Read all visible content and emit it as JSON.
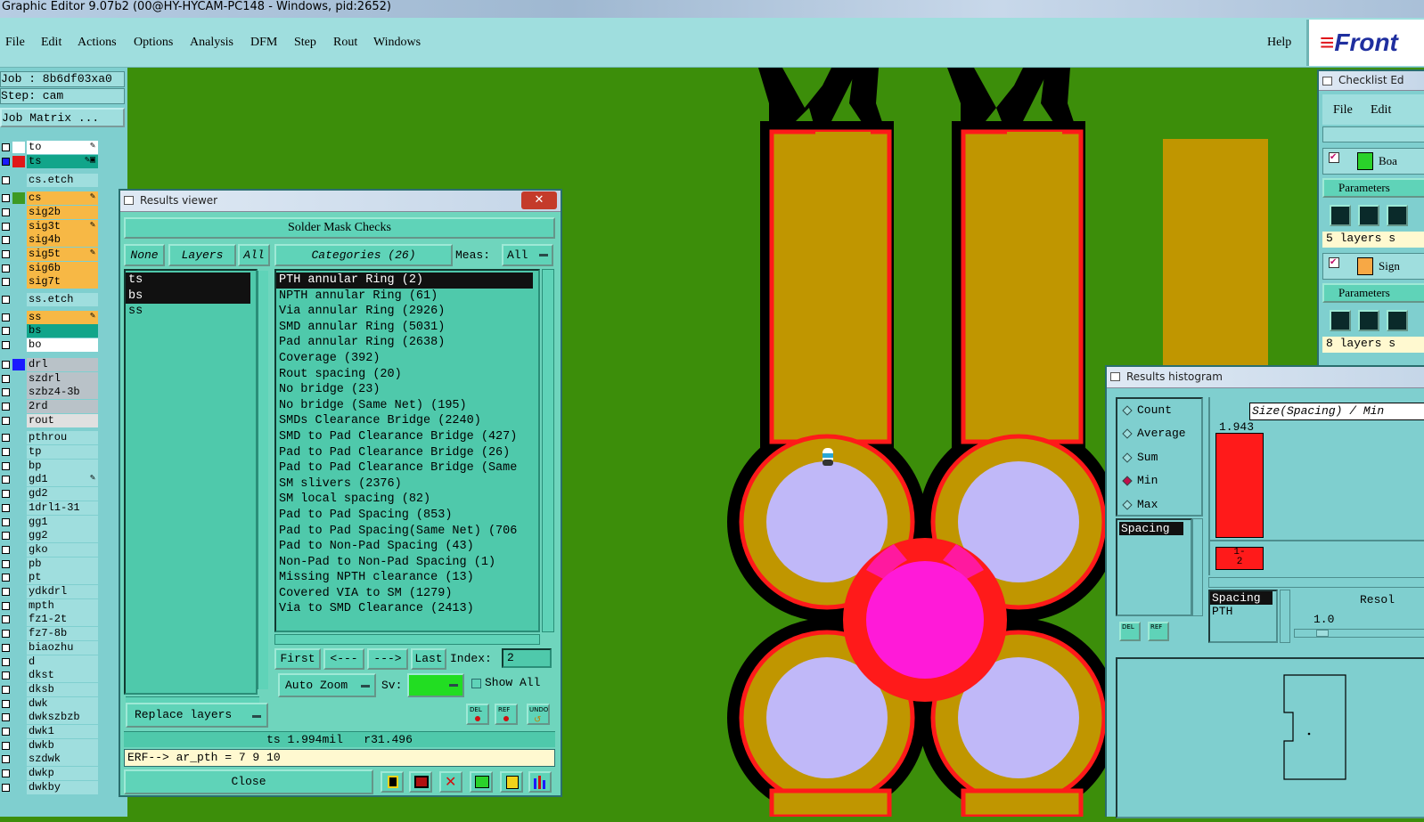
{
  "window_title": "Graphic Editor 9.07b2 (00@HY-HYCAM-PC148 - Windows, pid:2652)",
  "menu": {
    "items": [
      "File",
      "Edit",
      "Actions",
      "Options",
      "Analysis",
      "DFM",
      "Step",
      "Rout",
      "Windows"
    ],
    "help": "Help"
  },
  "logo": {
    "mark": "≡",
    "text": "Front"
  },
  "left_panel": {
    "job": "Job : 8b6df03xa0",
    "step": "Step: cam",
    "job_matrix": "Job Matrix ...",
    "layers": [
      {
        "name": "to",
        "color": "#ffffff",
        "swatch": "#ffffff",
        "mark": "✎"
      },
      {
        "name": "ts",
        "color": "#11a58a",
        "swatch": "#e01818",
        "mark": "✎▣",
        "checked_swatch": "#1a1aff"
      },
      {
        "name": "cs.etch",
        "color": "#9fdede",
        "swatch": "#7fcfcf",
        "mark": ""
      },
      {
        "name": "cs",
        "color": "#f7b845",
        "swatch": "#3d9a23",
        "mark": "✎"
      },
      {
        "name": "sig2b",
        "color": "#f7b845",
        "swatch": "#7fcfcf",
        "mark": ""
      },
      {
        "name": "sig3t",
        "color": "#f7b845",
        "swatch": "#7fcfcf",
        "mark": "✎"
      },
      {
        "name": "sig4b",
        "color": "#f7b845",
        "swatch": "#7fcfcf",
        "mark": ""
      },
      {
        "name": "sig5t",
        "color": "#f7b845",
        "swatch": "#7fcfcf",
        "mark": "✎"
      },
      {
        "name": "sig6b",
        "color": "#f7b845",
        "swatch": "#7fcfcf",
        "mark": ""
      },
      {
        "name": "sig7t",
        "color": "#f7b845",
        "swatch": "#7fcfcf",
        "mark": ""
      },
      {
        "name": "ss.etch",
        "color": "#9fdede",
        "swatch": "#7fcfcf",
        "mark": ""
      },
      {
        "name": "ss",
        "color": "#f7b845",
        "swatch": "#7fcfcf",
        "mark": "✎"
      },
      {
        "name": "bs",
        "color": "#11a58a",
        "swatch": "#7fcfcf",
        "mark": ""
      },
      {
        "name": "bo",
        "color": "#ffffff",
        "swatch": "#7fcfcf",
        "mark": ""
      },
      {
        "name": "drl",
        "color": "#b9c2c8",
        "swatch": "#1a1aff",
        "mark": ""
      },
      {
        "name": "szdrl",
        "color": "#b9c2c8",
        "swatch": "#7fcfcf",
        "mark": ""
      },
      {
        "name": "szbz4-3b",
        "color": "#b9c2c8",
        "swatch": "#7fcfcf",
        "mark": ""
      },
      {
        "name": "2rd",
        "color": "#b9c2c8",
        "swatch": "#7fcfcf",
        "mark": ""
      },
      {
        "name": "rout",
        "color": "#e0e0e0",
        "swatch": "#7fcfcf",
        "mark": ""
      },
      {
        "name": "pthrou",
        "color": "#9fdede",
        "swatch": "#7fcfcf",
        "mark": ""
      },
      {
        "name": "tp",
        "color": "#9fdede",
        "swatch": "#7fcfcf",
        "mark": ""
      },
      {
        "name": "bp",
        "color": "#9fdede",
        "swatch": "#7fcfcf",
        "mark": ""
      },
      {
        "name": "gd1",
        "color": "#9fdede",
        "swatch": "#7fcfcf",
        "mark": "✎"
      },
      {
        "name": "gd2",
        "color": "#9fdede",
        "swatch": "#7fcfcf",
        "mark": ""
      },
      {
        "name": "1drl1-31",
        "color": "#9fdede",
        "swatch": "#7fcfcf",
        "mark": ""
      },
      {
        "name": "gg1",
        "color": "#9fdede",
        "swatch": "#7fcfcf",
        "mark": ""
      },
      {
        "name": "gg2",
        "color": "#9fdede",
        "swatch": "#7fcfcf",
        "mark": ""
      },
      {
        "name": "gko",
        "color": "#9fdede",
        "swatch": "#7fcfcf",
        "mark": ""
      },
      {
        "name": "pb",
        "color": "#9fdede",
        "swatch": "#7fcfcf",
        "mark": ""
      },
      {
        "name": "pt",
        "color": "#9fdede",
        "swatch": "#7fcfcf",
        "mark": ""
      },
      {
        "name": "ydkdrl",
        "color": "#9fdede",
        "swatch": "#7fcfcf",
        "mark": ""
      },
      {
        "name": "mpth",
        "color": "#9fdede",
        "swatch": "#7fcfcf",
        "mark": ""
      },
      {
        "name": "fz1-2t",
        "color": "#9fdede",
        "swatch": "#7fcfcf",
        "mark": ""
      },
      {
        "name": "fz7-8b",
        "color": "#9fdede",
        "swatch": "#7fcfcf",
        "mark": ""
      },
      {
        "name": "biaozhu",
        "color": "#9fdede",
        "swatch": "#7fcfcf",
        "mark": ""
      },
      {
        "name": "d",
        "color": "#9fdede",
        "swatch": "#7fcfcf",
        "mark": ""
      },
      {
        "name": "dkst",
        "color": "#9fdede",
        "swatch": "#7fcfcf",
        "mark": ""
      },
      {
        "name": "dksb",
        "color": "#9fdede",
        "swatch": "#7fcfcf",
        "mark": ""
      },
      {
        "name": "dwk",
        "color": "#9fdede",
        "swatch": "#7fcfcf",
        "mark": ""
      },
      {
        "name": "dwkszbzb",
        "color": "#9fdede",
        "swatch": "#7fcfcf",
        "mark": ""
      },
      {
        "name": "dwk1",
        "color": "#9fdede",
        "swatch": "#7fcfcf",
        "mark": ""
      },
      {
        "name": "dwkb",
        "color": "#9fdede",
        "swatch": "#7fcfcf",
        "mark": ""
      },
      {
        "name": "szdwk",
        "color": "#9fdede",
        "swatch": "#7fcfcf",
        "mark": ""
      },
      {
        "name": "dwkp",
        "color": "#9fdede",
        "swatch": "#7fcfcf",
        "mark": ""
      },
      {
        "name": "dwkby",
        "color": "#9fdede",
        "swatch": "#7fcfcf",
        "mark": ""
      }
    ]
  },
  "results_viewer": {
    "title": "Results viewer",
    "close_x": "✕",
    "header": "Solder Mask Checks",
    "btn_none": "None",
    "btn_layers": "Layers",
    "btn_all": "All",
    "categories_btn": "Categories (26)",
    "meas_label": "Meas:",
    "meas_value": "All",
    "layers": [
      "ts",
      "bs",
      "ss"
    ],
    "categories": [
      "PTH annular Ring (2)",
      "NPTH annular Ring (61)",
      "Via annular Ring (2926)",
      "SMD annular Ring (5031)",
      "Pad annular Ring (2638)",
      "Coverage (392)",
      "Rout spacing (20)",
      "No bridge (23)",
      "No bridge (Same Net) (195)",
      "SMDs Clearance Bridge (2240)",
      "SMD to Pad Clearance Bridge (427)",
      "Pad to Pad Clearance Bridge (26)",
      "Pad to Pad Clearance Bridge (Same",
      "SM slivers (2376)",
      "SM local spacing (82)",
      "Pad to Pad Spacing (853)",
      "Pad to Pad Spacing(Same Net) (706",
      "Pad to Non-Pad Spacing (43)",
      "Non-Pad to Non-Pad Spacing (1)",
      "Missing NPTH clearance (13)",
      "Covered VIA to SM (1279)",
      "Via to SMD Clearance (2413)"
    ],
    "nav": {
      "first": "First",
      "prev": "<---",
      "next": "--->",
      "last": "Last",
      "index_label": "Index:",
      "index_value": "2"
    },
    "auto_zoom": "Auto Zoom",
    "sv_label": "Sv:",
    "show_all": "Show All",
    "replace_layers": "Replace layers",
    "status": "ts 1.994mil   r31.496",
    "erf": "ERF--> ar_pth = 7 9 10",
    "close": "Close",
    "icon_labels": {
      "del": "DEL",
      "ref": "REF",
      "undo": "UNDO"
    }
  },
  "checklist": {
    "title": "Checklist Ed",
    "menu": [
      "File",
      "Edit"
    ],
    "row1": "Boa",
    "params": "Parameters",
    "layers1": "5 layers s",
    "row2": "Sign",
    "layers2": "8 layers s"
  },
  "histogram": {
    "title": "Results histogram",
    "options": [
      "Count",
      "Average",
      "Sum",
      "Min",
      "Max"
    ],
    "selected": "Min",
    "header": "Size(Spacing) / Min",
    "value": "1.943",
    "bin_label": "1-\n2",
    "list_item": "Spacing",
    "list2": [
      "Spacing",
      "PTH"
    ],
    "resolution_label": "Resol",
    "resolution_value": "1.0",
    "icon_labels": {
      "del": "DEL",
      "ref": "REF"
    },
    "bar_value": 1.943
  },
  "colors": {
    "board": "#3c8e0a",
    "copper": "#c09600",
    "mask": "#000000",
    "violation": "#ff1a1a",
    "hole": "#c0b8f8",
    "highlight": "#ff1ad8"
  }
}
